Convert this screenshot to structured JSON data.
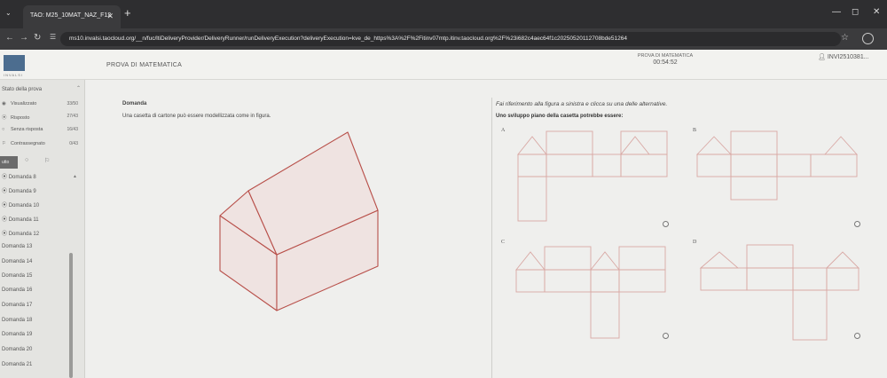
{
  "browser": {
    "tab_title": "TAO: M25_10MAT_NAZ_F12",
    "url": "ms10.invalsi.taocloud.org/__n/fuc/ltiDeliveryProvider/DeliveryRunner/runDeliveryExecution?deliveryExecution=kve_de_https%3A%2F%2Fitinv07mtp.itinv.taocloud.org%2F%23i682c4aec64f1c20250520112708bde51264"
  },
  "header": {
    "logo_text": "INVALSI",
    "app_title": "PROVA DI MATEMATICA",
    "test_name": "PROVA DI MATEMATICA",
    "timer": "00:54:52",
    "user": "INVI2510381..."
  },
  "sidebar": {
    "title": "Stato della prova",
    "stats": [
      {
        "label": "Visualizzato",
        "count": "33/50"
      },
      {
        "label": "Risposto",
        "count": "27/43"
      },
      {
        "label": "Senza risposta",
        "count": "16/43"
      },
      {
        "label": "Contrassegnato",
        "count": "0/43"
      }
    ],
    "filter_active": "utto",
    "items": [
      "Domanda 8",
      "Domanda 9",
      "Domanda 10",
      "Domanda 11",
      "Domanda 12",
      "Domanda 13",
      "Domanda 14",
      "Domanda 15",
      "Domanda 16",
      "Domanda 17",
      "Domanda 18",
      "Domanda 19",
      "Domanda 20",
      "Domanda 21"
    ]
  },
  "question": {
    "label": "Domanda",
    "text": "Una casetta di cartone può essere modellizzata come in figura.",
    "instruction": "Fai riferimento alla figura a sinistra e clicca su una delle alternative.",
    "prompt": "Uno sviluppo piano della casetta potrebbe essere:",
    "options": [
      {
        "letter": "A"
      },
      {
        "letter": "B"
      },
      {
        "letter": "C"
      },
      {
        "letter": "D"
      }
    ]
  },
  "colors": {
    "figure_stroke": "#b8504a",
    "net_stroke": "#d9a8a4",
    "house_fill": "#efe3e1"
  }
}
